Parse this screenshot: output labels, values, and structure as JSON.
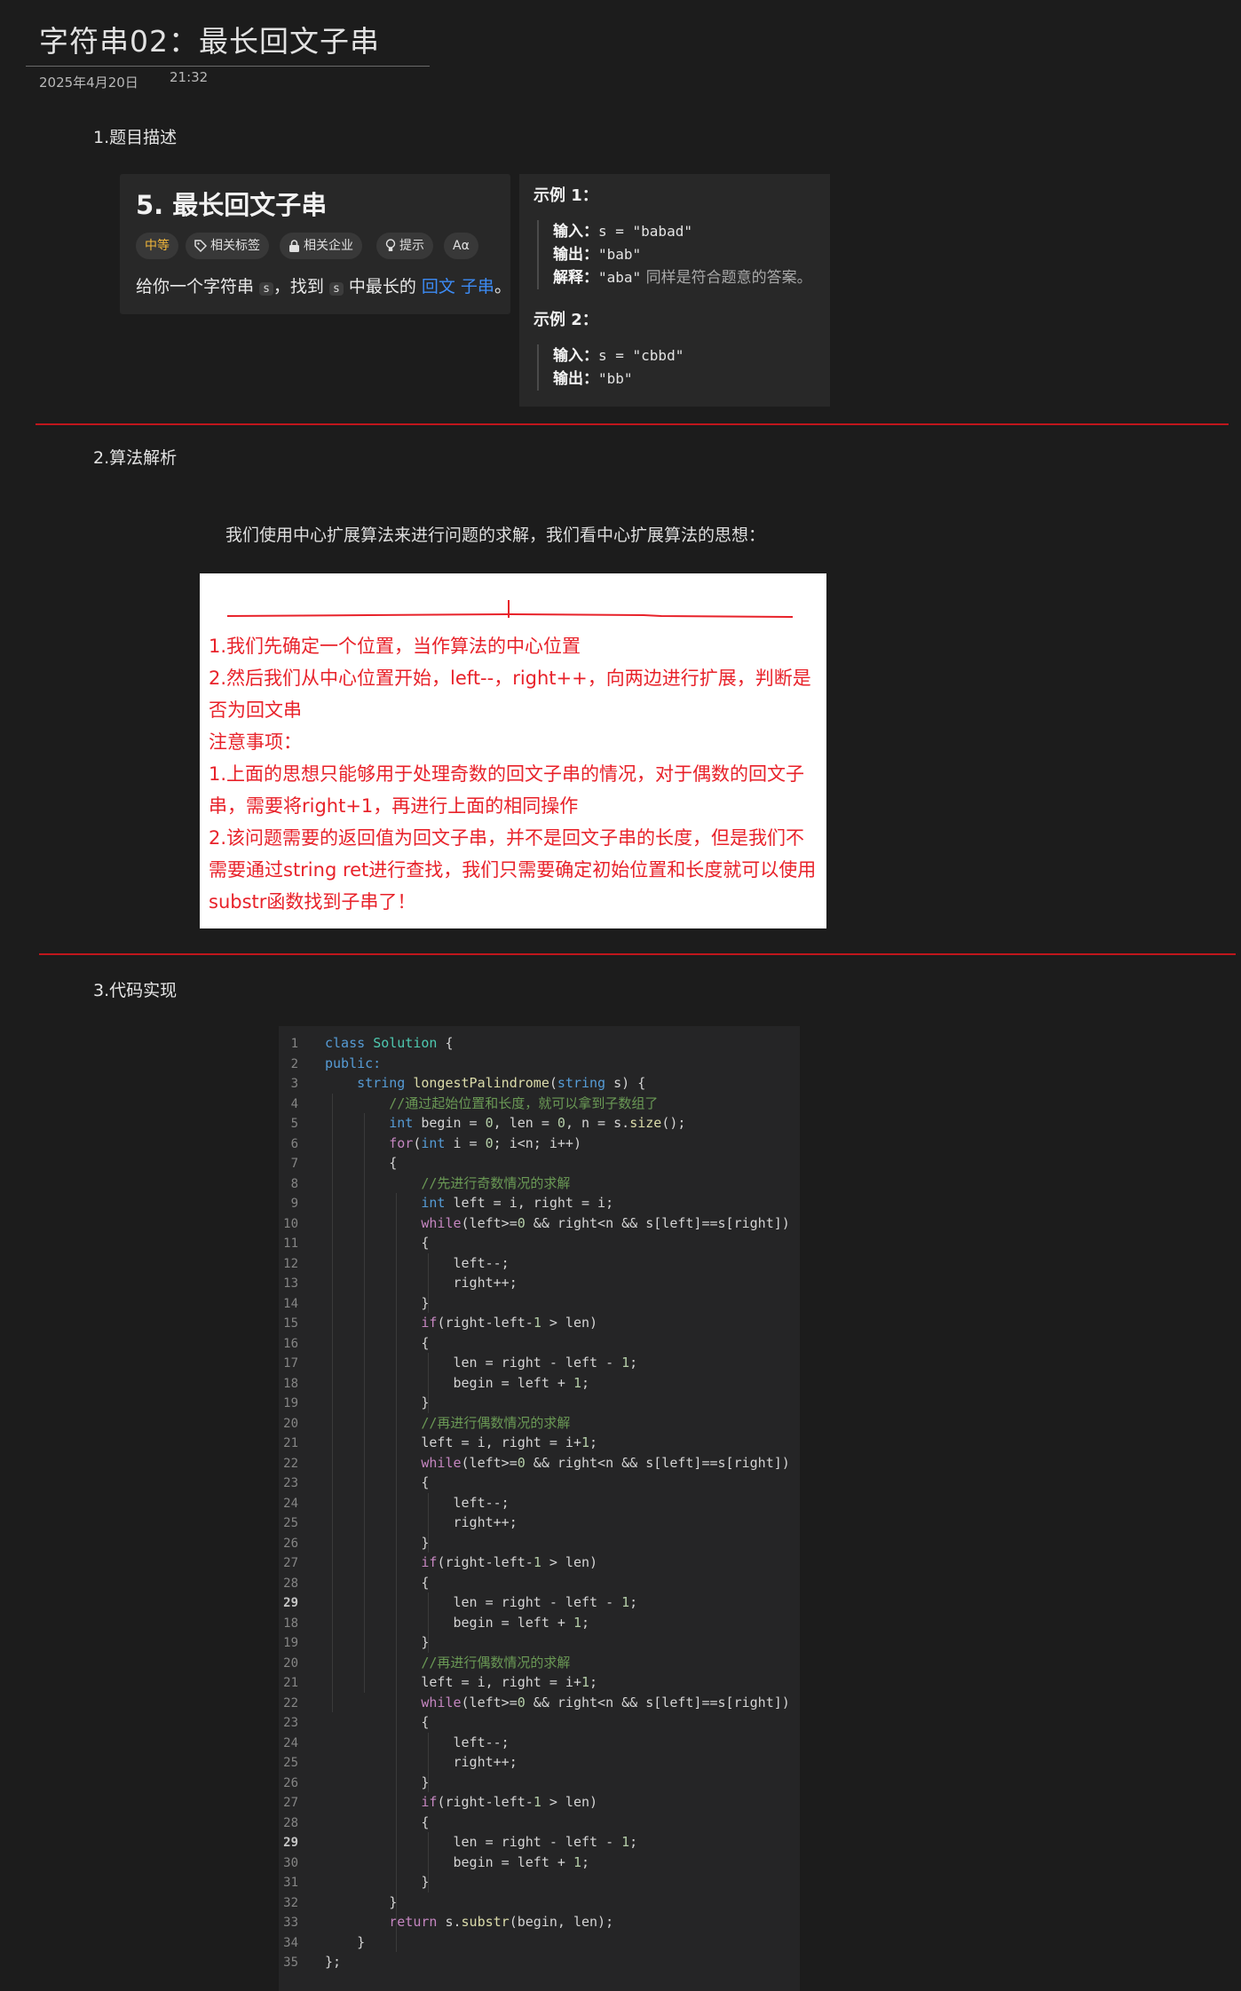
{
  "header": {
    "title": "字符串02：最长回文子串",
    "date": "2025年4月20日",
    "time": "21:32"
  },
  "sections": {
    "s1": "1.题目描述",
    "s2": "2.算法解析",
    "s3": "3.代码实现"
  },
  "problem": {
    "title": "5. 最长回文子串",
    "tags": {
      "difficulty": "中等",
      "related_tags": "相关标签",
      "related_companies": "相关企业",
      "hint": "提示",
      "font": "Aα"
    },
    "desc_pre": "给你一个字符串",
    "desc_var1": "s",
    "desc_mid": "，找到",
    "desc_var2": "s",
    "desc_post": "中最长的",
    "desc_link": "回文 子串",
    "desc_end": "。"
  },
  "examples": {
    "ex1_title": "示例 1：",
    "ex1_input_label": "输入：",
    "ex1_input": "s = \"babad\"",
    "ex1_output_label": "输出：",
    "ex1_output": "\"bab\"",
    "ex1_explain_label": "解释：",
    "ex1_explain_code": "\"aba\"",
    "ex1_explain_text": "同样是符合题意的答案。",
    "ex2_title": "示例 2：",
    "ex2_input_label": "输入：",
    "ex2_input": "s = \"cbbd\"",
    "ex2_output_label": "输出：",
    "ex2_output": "\"bb\""
  },
  "analysis": {
    "intro": "我们使用中心扩展算法来进行问题的求解，我们看中心扩展算法的思想：",
    "notes": [
      "1.我们先确定一个位置，当作算法的中心位置",
      "2.然后我们从中心位置开始，left--，right++，向两边进行扩展，判断是否为回文串",
      "注意事项：",
      "1.上面的思想只能够用于处理奇数的回文子串的情况，对于偶数的回文子串，需要将right+1，再进行上面的相同操作",
      "2.该问题需要的返回值为回文子串，并不是回文子串的长度，但是我们不需要通过string ret进行查找，我们只需要确定初始位置和长度就可以使用substr函数找到子串了！"
    ]
  },
  "code": {
    "colors": {
      "keyword": "#569cd6",
      "type": "#4ec9b0",
      "func": "#dcdcaa",
      "comment": "#6a9955",
      "number": "#b5cea8",
      "text": "#d4d4d4",
      "control": "#c586c0"
    },
    "lines": [
      {
        "n": "1",
        "t": "class Solution {"
      },
      {
        "n": "2",
        "t": "public:"
      },
      {
        "n": "3",
        "t": "    string longestPalindrome(string s) {"
      },
      {
        "n": "4",
        "t": "        //通过起始位置和长度，就可以拿到子数组了"
      },
      {
        "n": "5",
        "t": "        int begin = 0, len = 0, n = s.size();"
      },
      {
        "n": "6",
        "t": "        for(int i = 0; i<n; i++)"
      },
      {
        "n": "7",
        "t": "        {"
      },
      {
        "n": "8",
        "t": "            //先进行奇数情况的求解"
      },
      {
        "n": "9",
        "t": "            int left = i, right = i;"
      },
      {
        "n": "10",
        "t": "            while(left>=0 && right<n && s[left]==s[right])"
      },
      {
        "n": "11",
        "t": "            {"
      },
      {
        "n": "12",
        "t": "                left--;"
      },
      {
        "n": "13",
        "t": "                right++;"
      },
      {
        "n": "14",
        "t": "            }"
      },
      {
        "n": "15",
        "t": "            if(right-left-1 > len)"
      },
      {
        "n": "16",
        "t": "            {"
      },
      {
        "n": "17",
        "t": "                len = right - left - 1;"
      },
      {
        "n": "18",
        "t": "                begin = left + 1;"
      },
      {
        "n": "19",
        "t": "            }"
      },
      {
        "n": "20",
        "t": "            //再进行偶数情况的求解"
      },
      {
        "n": "21",
        "t": "            left = i, right = i+1;"
      },
      {
        "n": "22",
        "t": "            while(left>=0 && right<n && s[left]==s[right])"
      },
      {
        "n": "23",
        "t": "            {"
      },
      {
        "n": "24",
        "t": "                left--;"
      },
      {
        "n": "25",
        "t": "                right++;"
      },
      {
        "n": "26",
        "t": "            }"
      },
      {
        "n": "27",
        "t": "            if(right-left-1 > len)"
      },
      {
        "n": "28",
        "t": "            {"
      },
      {
        "n": "29",
        "t": "                len = right - left - 1;",
        "hl": true
      },
      {
        "n": "18",
        "t": "                begin = left + 1;"
      },
      {
        "n": "19",
        "t": "            }"
      },
      {
        "n": "20",
        "t": "            //再进行偶数情况的求解"
      },
      {
        "n": "21",
        "t": "            left = i, right = i+1;"
      },
      {
        "n": "22",
        "t": "            while(left>=0 && right<n && s[left]==s[right])"
      },
      {
        "n": "23",
        "t": "            {"
      },
      {
        "n": "24",
        "t": "                left--;"
      },
      {
        "n": "25",
        "t": "                right++;"
      },
      {
        "n": "26",
        "t": "            }"
      },
      {
        "n": "27",
        "t": "            if(right-left-1 > len)"
      },
      {
        "n": "28",
        "t": "            {"
      },
      {
        "n": "29",
        "t": "                len = right - left - 1;",
        "hl": true
      },
      {
        "n": "30",
        "t": "                begin = left + 1;"
      },
      {
        "n": "31",
        "t": "            }"
      },
      {
        "n": "32",
        "t": "        }"
      },
      {
        "n": "33",
        "t": "        return s.substr(begin, len);"
      },
      {
        "n": "34",
        "t": "    }"
      },
      {
        "n": "35",
        "t": "};"
      }
    ]
  }
}
